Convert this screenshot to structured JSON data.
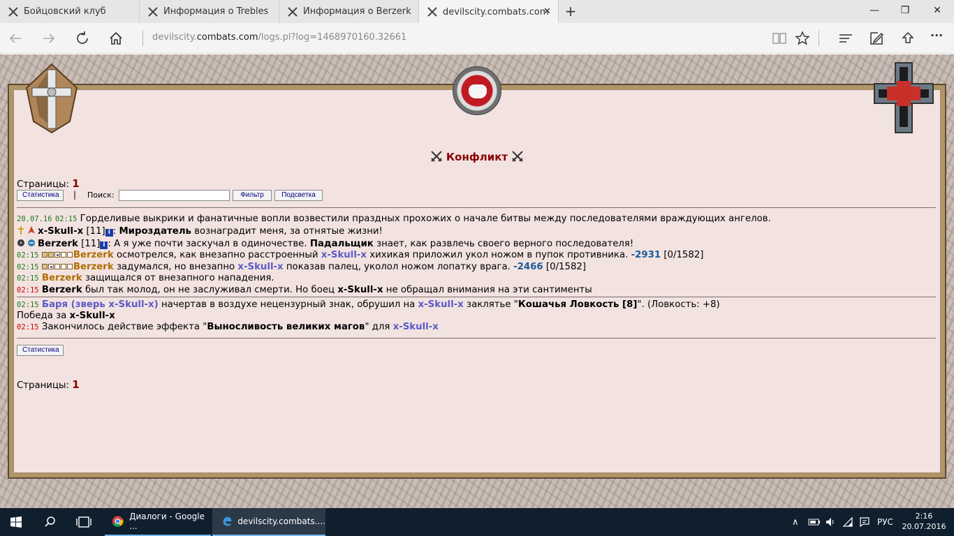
{
  "browser": {
    "tabs": [
      {
        "title": "Бойцовский клуб",
        "active": false
      },
      {
        "title": "Информация о Trebles",
        "active": false
      },
      {
        "title": "Информация о Berzerk",
        "active": false
      },
      {
        "title": "devilscity.combats.com",
        "active": true
      }
    ],
    "close_glyph": "✕",
    "new_tab_glyph": "+",
    "window_controls": {
      "minimize": "—",
      "restore": "❐",
      "close": "✕"
    },
    "address": {
      "prefix": "devilscity.",
      "host": "combats.com",
      "path": "/logs.pl?log=1468970160.32661"
    },
    "nav_icons": [
      "back-icon",
      "forward-icon",
      "refresh-icon",
      "home-icon",
      "reading-view-icon",
      "favorite-star-icon",
      "hub-icon",
      "web-note-icon",
      "share-icon",
      "more-icon"
    ],
    "more_glyph": "···"
  },
  "page": {
    "title": "Конфликт",
    "pages_label": "Страницы:",
    "pages_value": "1",
    "stats_button": "Статистика",
    "separator": "|",
    "search_label": "Поиск:",
    "search_value": "",
    "filter_button": "Фильтр",
    "highlight_button": "Подсветка",
    "log": {
      "l1": {
        "date": "20.07.16",
        "time": "02:15",
        "text": "Горделивые выкрики и фанатичные вопли возвестили праздных прохожих о начале битвы между последователями враждующих ангелов."
      },
      "l2": {
        "name": "x-Skull-x",
        "level": "[11]",
        "sep": ":",
        "god": "Мироздатель",
        "text": "вознаградит меня, за отнятые жизни!"
      },
      "l3": {
        "name": "Berzerk",
        "level": "[11]",
        "sep": ":",
        "text1": "А я уже почти заскучал в одиночестве.",
        "god": "Падальщик",
        "text2": "знает, как развлечь своего верного последователя!"
      },
      "l4": {
        "time": "02:15",
        "actor": "Berzerk",
        "t1": "осмотрелся, как внезапно расстроенный",
        "target": "x-Skull-x",
        "t2": "хихикая приложил укол ножом в пупок противника.",
        "dmg": "-2931",
        "hp": "[0/1582]"
      },
      "l5": {
        "time": "02:15",
        "actor": "Berzerk",
        "t1": "задумался, но внезапно",
        "target": "x-Skull-x",
        "t2": "показав палец, уколол ножом лопатку врага.",
        "dmg": "-2466",
        "hp": "[0/1582]"
      },
      "l6": {
        "time": "02:15",
        "actor": "Berzerk",
        "text": "защищался от внезапного нападения."
      },
      "l7": {
        "time": "02:15",
        "actor": "Berzerk",
        "t1": "был так молод, он не заслуживал смерти. Но боец",
        "target": "x-Skull-x",
        "t2": "не обращал внимания на эти сантименты"
      },
      "l8": {
        "time": "02:15",
        "actor": "Баря (зверь x-Skull-x)",
        "t1": "начертав в воздухе нецензурный знак, обрушил на",
        "target": "x-Skull-x",
        "t2": "заклятье \"",
        "spell": "Кошачья Ловкость [8]",
        "t3": "\". (Ловкость: +8)"
      },
      "l9": {
        "text": "Победа за",
        "winner": "x-Skull-x"
      },
      "l10": {
        "time": "02:15",
        "t1": "Закончилось действие эффекта \"",
        "effect": "Выносливость великих магов",
        "t2": "\" для",
        "target": "x-Skull-x"
      }
    }
  },
  "taskbar": {
    "items": [
      {
        "label": "Диалоги - Google ...",
        "icon": "chrome-icon"
      },
      {
        "label": "devilscity.combats....",
        "icon": "edge-icon"
      }
    ],
    "lang": "РУС",
    "time": "2:16",
    "date": "20.07.2016",
    "tray_chevron": "∧"
  },
  "colors": {
    "title_red": "#8b0000",
    "name_brown": "#b06c00",
    "name_blue": "#5a5ac8",
    "time_green": "#1a7a1a",
    "time_red": "#cc0000",
    "page_bg": "#f2e3e1"
  }
}
